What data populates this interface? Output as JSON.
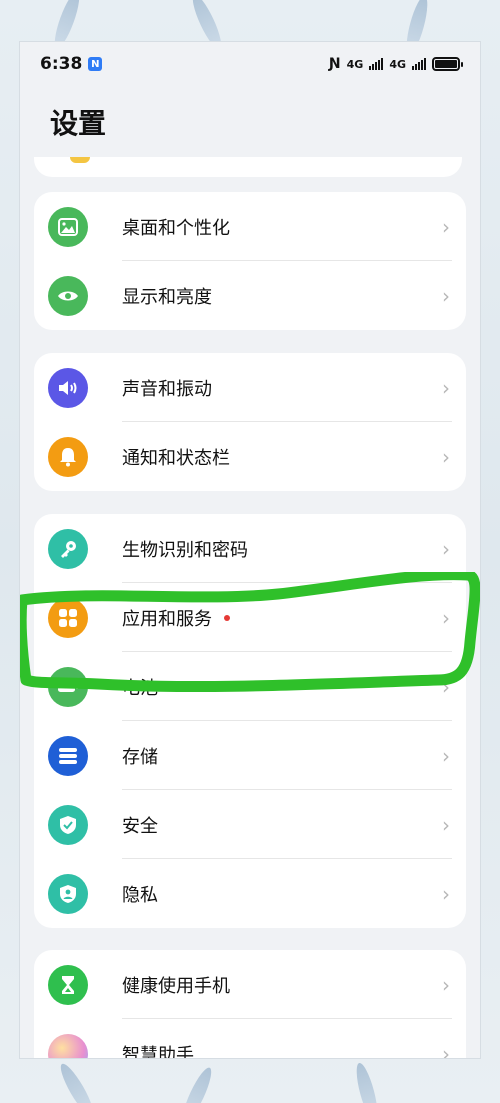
{
  "status_bar": {
    "time": "6:38",
    "nfc_badge": "N",
    "network_1": "4G",
    "network_2": "4G"
  },
  "page": {
    "title": "设置"
  },
  "groups": [
    {
      "items": [
        {
          "label": "桌面和个性化",
          "icon": "wallpaper-icon",
          "color": "#49b85b"
        },
        {
          "label": "显示和亮度",
          "icon": "eye-icon",
          "color": "#49b85b"
        }
      ]
    },
    {
      "items": [
        {
          "label": "声音和振动",
          "icon": "speaker-icon",
          "color": "#5b57e6"
        },
        {
          "label": "通知和状态栏",
          "icon": "bell-icon",
          "color": "#f39c12"
        }
      ]
    },
    {
      "items": [
        {
          "label": "生物识别和密码",
          "icon": "key-icon",
          "color": "#2fbfa6"
        },
        {
          "label": "应用和服务",
          "icon": "apps-icon",
          "color": "#f39c12",
          "badge": "red-dot"
        },
        {
          "label": "电池",
          "icon": "battery-icon",
          "color": "#49b85b"
        },
        {
          "label": "存储",
          "icon": "storage-icon",
          "color": "#1f5fd6"
        },
        {
          "label": "安全",
          "icon": "shield-check-icon",
          "color": "#2fbfa6"
        },
        {
          "label": "隐私",
          "icon": "privacy-shield-icon",
          "color": "#2fbfa6"
        }
      ]
    },
    {
      "items": [
        {
          "label": "健康使用手机",
          "icon": "hourglass-icon",
          "color": "#2fbf4e"
        },
        {
          "label": "智慧助手",
          "icon": "assistant-icon",
          "color": "#e88fd0"
        }
      ]
    }
  ],
  "annotation_color": "#2fc02a"
}
